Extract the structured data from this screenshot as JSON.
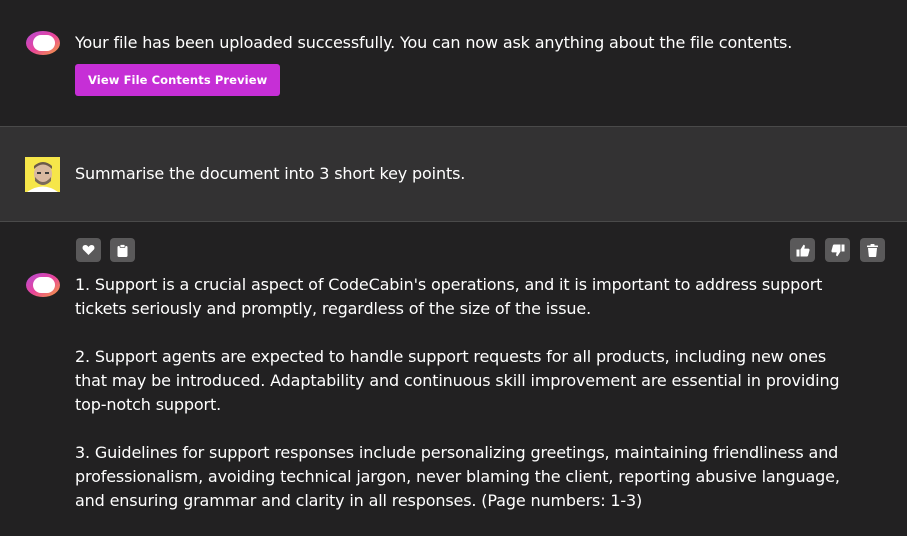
{
  "messages": {
    "upload": {
      "text": "Your file has been uploaded successfully. You can now ask anything about the file contents.",
      "button_label": "View File Contents Preview"
    },
    "user": {
      "text": "Summarise the document into 3 short key points."
    },
    "answer": {
      "points": [
        "1. Support is a crucial aspect of CodeCabin's operations, and it is important to address support tickets seriously and promptly, regardless of the size of the issue.",
        "2. Support agents are expected to handle support requests for all products, including new ones that may be introduced. Adaptability and continuous skill improvement are essential in providing top-notch support.",
        "3. Guidelines for support responses include personalizing greetings, maintaining friendliness and professionalism, avoiding technical jargon, never blaming the client, reporting abusive language, and ensuring grammar and clarity in all responses. (Page numbers: 1-3)"
      ]
    }
  },
  "actions": {
    "left": [
      "heart-icon",
      "clipboard-icon"
    ],
    "right": [
      "thumbs-up-icon",
      "thumbs-down-icon",
      "trash-icon"
    ]
  },
  "colors": {
    "background": "#222122",
    "user_row": "#333233",
    "accent_button": "#c62fd6",
    "icon_button": "#5a595a",
    "logo_pink": "#e8449c",
    "logo_orange": "#f5a13a"
  }
}
